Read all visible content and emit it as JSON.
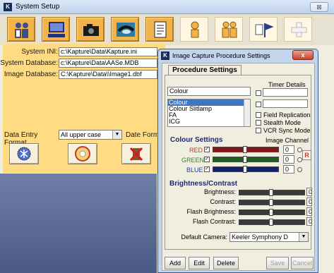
{
  "main": {
    "title": "System Setup",
    "close_label": "⊠",
    "toolbar": [
      {
        "icon": "users-icon"
      },
      {
        "icon": "computer-icon"
      },
      {
        "icon": "camera-icon"
      },
      {
        "icon": "eye-icon"
      },
      {
        "icon": "document-icon"
      },
      {
        "icon": "person-icon"
      },
      {
        "icon": "group-icon"
      },
      {
        "icon": "flag-icon"
      },
      {
        "icon": "add-icon"
      }
    ],
    "fields": {
      "system_ini_label": "System INI:",
      "system_ini_value": "c:\\Kapture\\Data\\Kapture.ini",
      "system_db_label": "System Database:",
      "system_db_value": "c:\\Kapture\\Data\\AASe.MDB",
      "image_db_label": "Image Database:",
      "image_db_value": "C:\\Kapture\\Data\\\\Image1.dbf",
      "entry_format_label": "Data Entry Format",
      "entry_format_value": "All upper case",
      "date_format_label": "Date Form"
    }
  },
  "dialog": {
    "title": "Image Capture Procedure Settings",
    "close_label": "x",
    "tab_label": "Procedure Settings",
    "procedure_value": "Colour",
    "procedure_list": [
      "Colour",
      "Colour Slitlamp",
      "FA",
      "ICG"
    ],
    "timer_label": "Timer Details",
    "checks": {
      "field_replication": "Field Replication",
      "stealth_mode": "Stealth Mode",
      "vcr_sync": "VCR Sync Mode"
    },
    "colour_settings_label": "Colour Settings",
    "image_channel_label": "Image Channel",
    "channels": [
      {
        "name": "RED",
        "checked": "✓",
        "value": "0",
        "color": "#c0392b"
      },
      {
        "name": "GREEN",
        "checked": "✓",
        "value": "0",
        "color": "#2e8b2e"
      },
      {
        "name": "BLUE",
        "checked": "✓",
        "value": "0",
        "color": "#1f3fa6"
      }
    ],
    "r_button": "R",
    "brightness_label": "Brightness/Contrast",
    "adjust": [
      {
        "name": "Brightness:",
        "value": "0"
      },
      {
        "name": "Contrast:",
        "value": "0"
      },
      {
        "name": "Flash Brightness:",
        "value": "0"
      },
      {
        "name": "Flash Contrast:",
        "value": "0"
      }
    ],
    "default_camera_label": "Default Camera:",
    "default_camera_value": "Keeler Symphony D",
    "buttons": {
      "add": "Add",
      "edit": "Edit",
      "delete": "Delete",
      "save": "Save",
      "cancel": "Cancel"
    }
  }
}
